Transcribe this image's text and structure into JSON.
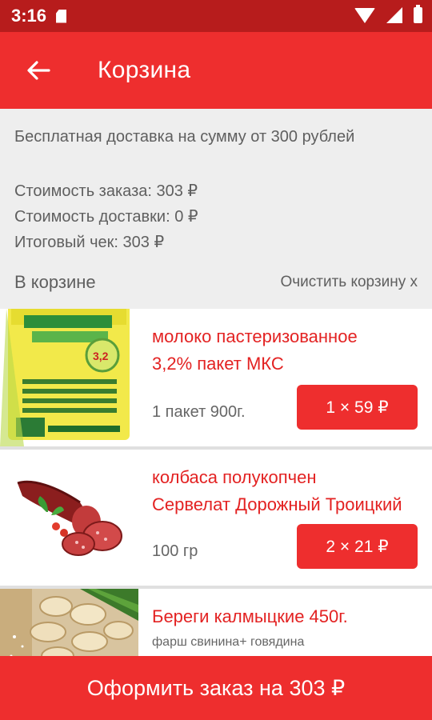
{
  "status": {
    "time": "3:16"
  },
  "app_bar": {
    "title": "Корзина"
  },
  "summary": {
    "free_delivery": "Бесплатная доставка на сумму от 300 рублей",
    "order_cost": "Стоимость заказа: 303 ₽",
    "delivery_cost": "Стоимость доставки: 0 ₽",
    "total": "Итоговый чек: 303 ₽",
    "in_cart_label": "В корзине",
    "clear_cart": "Очистить корзину х"
  },
  "items": [
    {
      "title_line1": "молоко пастеризованное",
      "title_line2": "3,2% пакет МКС",
      "desc": "1 пакет 900г.",
      "qty_label": "1 × 59 ₽",
      "image": "milk-package"
    },
    {
      "title_line1": "колбаса полукопчен",
      "title_line2": "Сервелат Дорожный Троицкий",
      "desc": "100 гр",
      "qty_label": "2 × 21 ₽",
      "image": "sausage"
    },
    {
      "title_line1": "Береги калмыцкие 450г.",
      "desc": "фарш свинина+ говядина",
      "image": "dumplings"
    }
  ],
  "checkout": {
    "label": "Оформить заказ на 303 ₽"
  },
  "colors": {
    "primary": "#ee2e2e",
    "status_bar": "#b71c1c",
    "title_red": "#e32222"
  }
}
